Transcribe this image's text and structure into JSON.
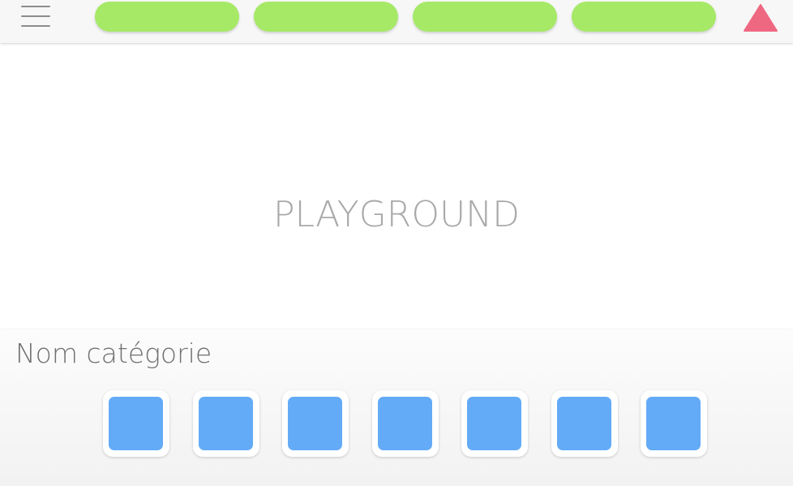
{
  "topbar": {
    "menu_icon": "hamburger-menu-icon",
    "pills": [
      {
        "label": "",
        "color": "#a6e966"
      },
      {
        "label": "",
        "color": "#a6e966"
      },
      {
        "label": "",
        "color": "#a6e966"
      },
      {
        "label": "",
        "color": "#a6e966"
      }
    ],
    "alert_icon": "triangle-icon",
    "alert_color": "#ef6882"
  },
  "playground": {
    "label": "PLAYGROUND"
  },
  "category": {
    "title": "Nom catégorie",
    "tile_color": "#63abf7",
    "tiles": [
      "",
      "",
      "",
      "",
      "",
      "",
      ""
    ]
  }
}
